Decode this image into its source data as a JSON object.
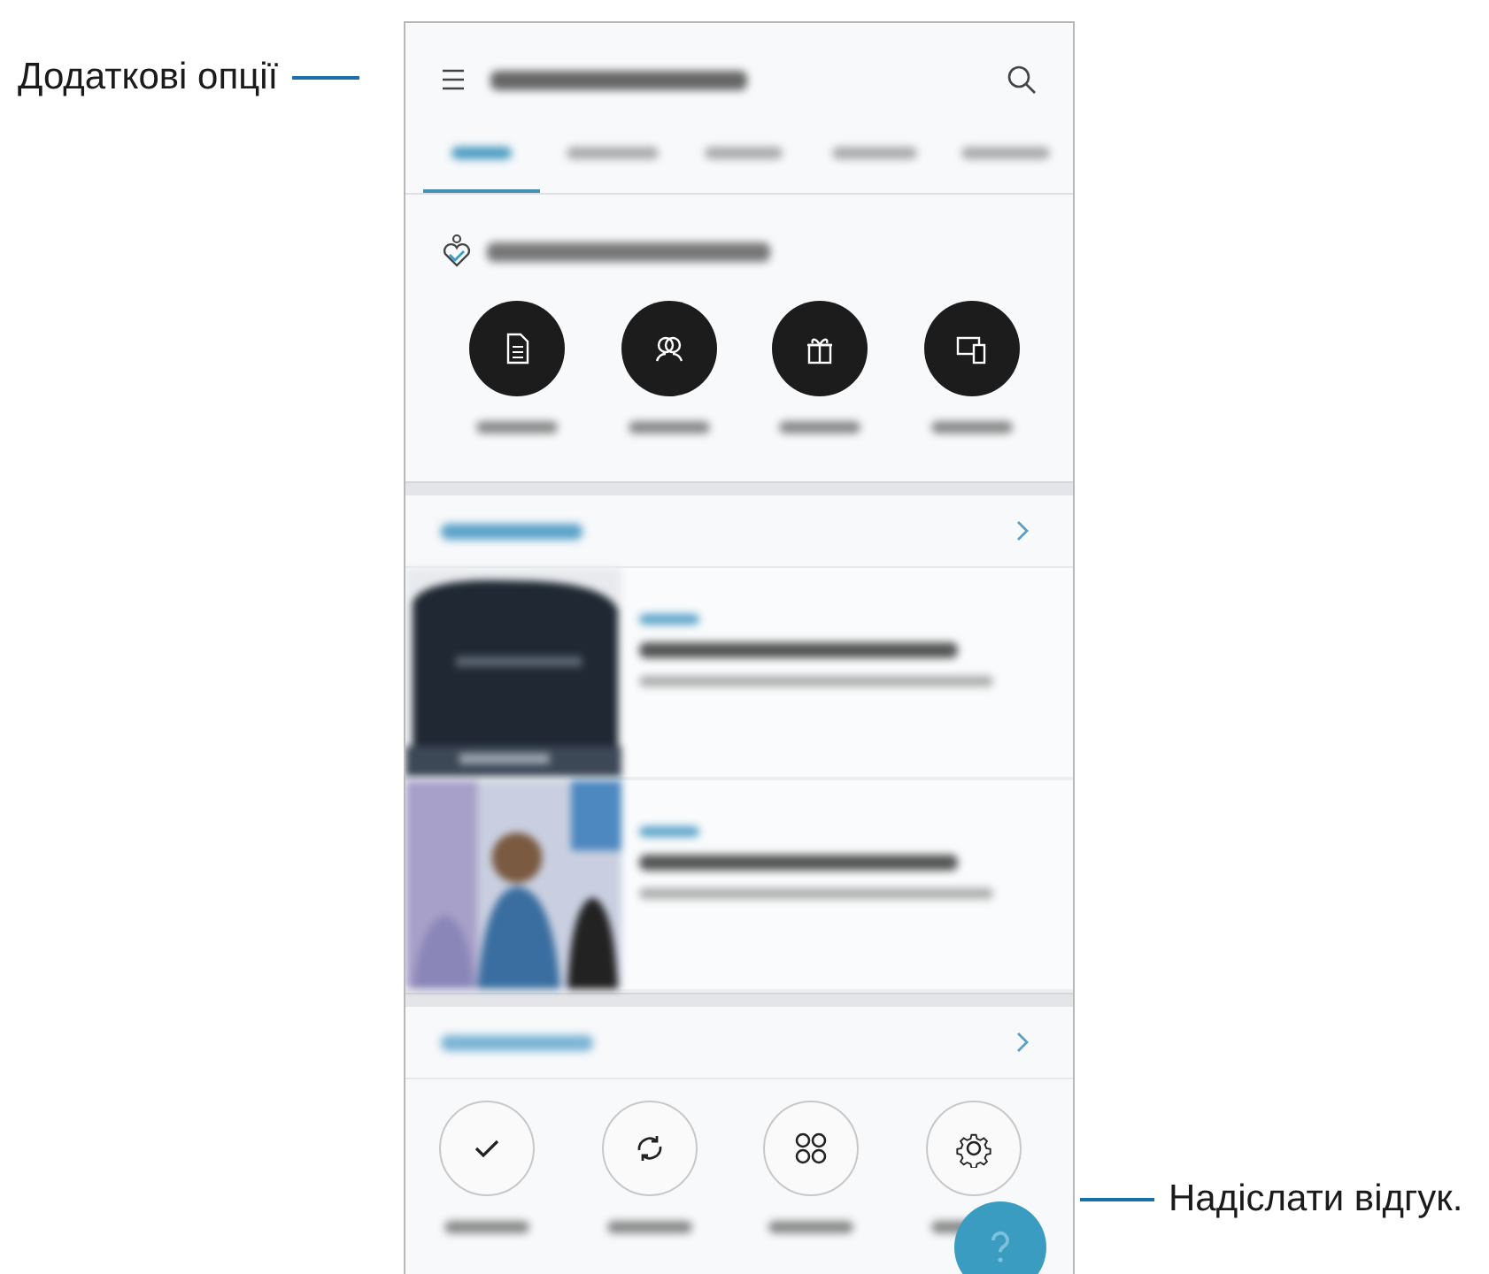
{
  "callouts": [
    {
      "kind": "left",
      "label": "Додаткові опції"
    },
    {
      "kind": "right",
      "label": "Надіслати відгук."
    }
  ],
  "tabs": [
    {
      "selected": true
    },
    {
      "selected": false
    },
    {
      "selected": false
    },
    {
      "selected": false
    },
    {
      "selected": false
    }
  ],
  "shortcuts": [
    {
      "kind": "document"
    },
    {
      "kind": "community"
    },
    {
      "kind": "gift"
    },
    {
      "kind": "devices"
    }
  ],
  "tools": [
    {
      "kind": "check"
    },
    {
      "kind": "refresh"
    },
    {
      "kind": "apps"
    },
    {
      "kind": "settings"
    }
  ]
}
